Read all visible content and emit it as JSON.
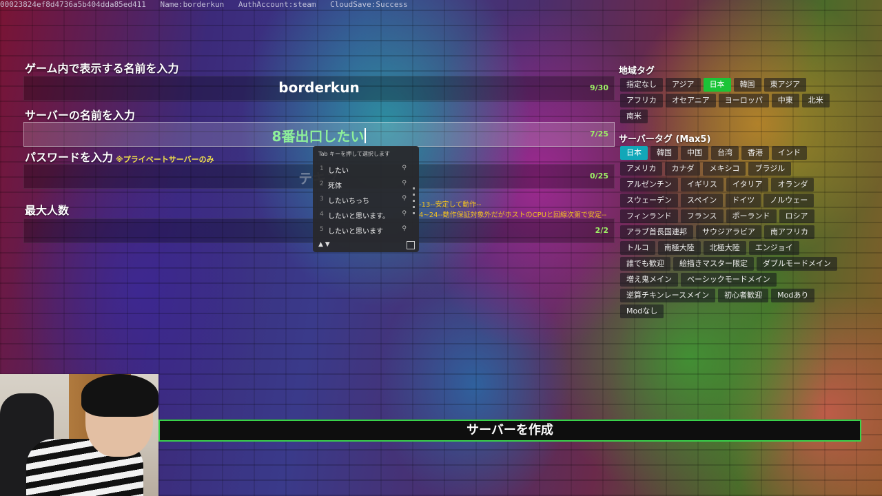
{
  "debug": {
    "id": "00023824ef8d4736a5b404dda85ed411",
    "name": "Name:borderkun",
    "auth": "AuthAccount:steam",
    "cloud": "CloudSave:Success"
  },
  "form": {
    "name_label": "ゲーム内で表示する名前を入力",
    "name_value": "borderkun",
    "name_count": "9/30",
    "server_label": "サーバーの名前を入力",
    "server_value": "8番出口したい",
    "server_count": "7/25",
    "password_label": "パスワードを入力",
    "password_note": "※プライベートサーバーのみ",
    "password_placeholder": "テキス",
    "password_count": "0/25",
    "max_label": "最大人数",
    "max_count": "2/2",
    "version_note_1": "-13--安定して動作--",
    "version_note_2": "4~24--動作保証対象外だがホストのCPUと回線次第で安定--"
  },
  "ime": {
    "hint": "Tab キーを押して選択します",
    "candidates": [
      {
        "num": "1",
        "word": "したい"
      },
      {
        "num": "2",
        "word": "死体"
      },
      {
        "num": "3",
        "word": "したいちっち"
      },
      {
        "num": "4",
        "word": "したいと思います。"
      },
      {
        "num": "5",
        "word": "したいと思います"
      }
    ],
    "nav": "▲ ▼"
  },
  "region": {
    "title": "地域タグ",
    "tags": [
      "指定なし",
      "アジア",
      "日本",
      "韓国",
      "東アジア",
      "アフリカ",
      "オセアニア",
      "ヨーロッパ",
      "中東",
      "北米",
      "南米"
    ],
    "selected": "日本"
  },
  "server_tags": {
    "title": "サーバータグ (Max5)",
    "tags": [
      "日本",
      "韓国",
      "中国",
      "台湾",
      "香港",
      "インド",
      "アメリカ",
      "カナダ",
      "メキシコ",
      "ブラジル",
      "アルゼンチン",
      "イギリス",
      "イタリア",
      "オランダ",
      "スウェーデン",
      "スペイン",
      "ドイツ",
      "ノルウェー",
      "フィンランド",
      "フランス",
      "ポーランド",
      "ロシア",
      "アラブ首長国連邦",
      "サウジアラビア",
      "南アフリカ",
      "トルコ",
      "南極大陸",
      "北極大陸",
      "エンジョイ",
      "誰でも歓迎",
      "絵描きマスター限定",
      "ダブルモードメイン",
      "増え鬼メイン",
      "ベーシックモードメイン",
      "逆算チキンレースメイン",
      "初心者歓迎",
      "Modあり",
      "Modなし"
    ],
    "selected": "日本"
  },
  "create_button": "サーバーを作成",
  "colors": {
    "accent_green": "#39d24b",
    "selected_teal": "#12a7b8",
    "count_green": "#9ef066",
    "note_yellow": "#f0e04a"
  }
}
